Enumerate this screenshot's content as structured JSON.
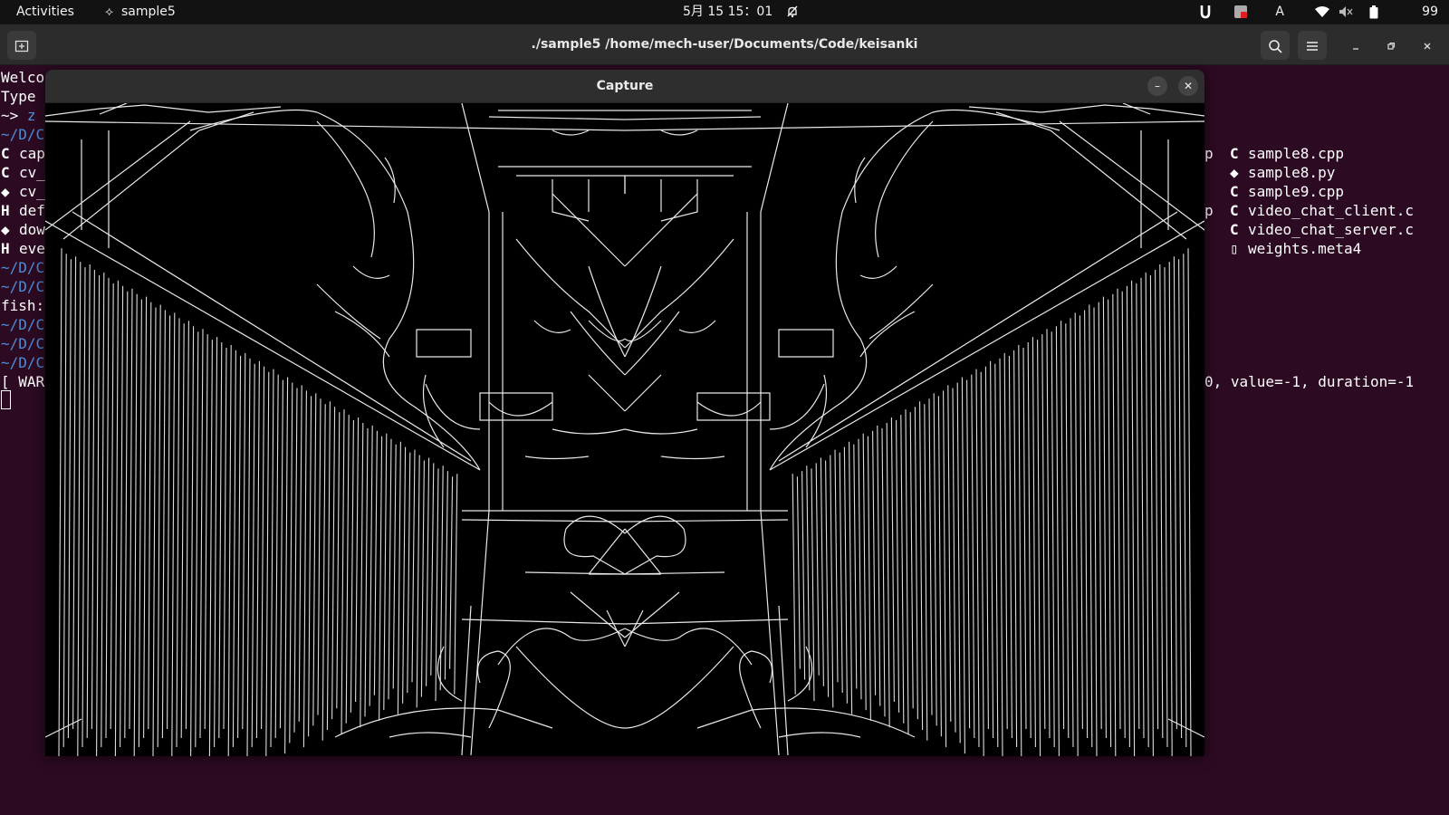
{
  "topbar": {
    "activities": "Activities",
    "app_name": "sample5",
    "clock": "5月 15  15：01",
    "bell_icon": "bell-muted-icon",
    "tray": {
      "input_method": "A",
      "battery": "99 %"
    }
  },
  "terminal": {
    "title": "./sample5 /home/mech-user/Documents/Code/keisanki",
    "left_lines": [
      "Welco",
      "Type ",
      "~> ",
      "~/D/C",
      "cap",
      "cv_",
      "cv_",
      "def",
      "dow",
      "eve",
      "~/D/C",
      "~/D/C",
      "fish:",
      "~/D/C",
      "~/D/C",
      "~/D/C",
      "[ WAR"
    ],
    "prompt_partial": "z",
    "right_files": [
      {
        "icon": "cpp-file-icon",
        "glyph": "C",
        "name": "sample8.cpp"
      },
      {
        "icon": "python-file-icon",
        "glyph": "◆",
        "name": "sample8.py"
      },
      {
        "icon": "cpp-file-icon",
        "glyph": "C",
        "name": "sample9.cpp"
      },
      {
        "icon": "c-file-icon",
        "glyph": "C",
        "name": "video_chat_client.c"
      },
      {
        "icon": "c-file-icon",
        "glyph": "C",
        "name": "video_chat_server.c"
      },
      {
        "icon": "file-icon",
        "glyph": "▯",
        "name": "weights.meta4"
      }
    ],
    "right_fragments": [
      "p",
      "p"
    ],
    "warning_tail": "0, value=-1, duration=-1"
  },
  "capture": {
    "title": "Capture",
    "minimize": "–",
    "close": "✕"
  }
}
